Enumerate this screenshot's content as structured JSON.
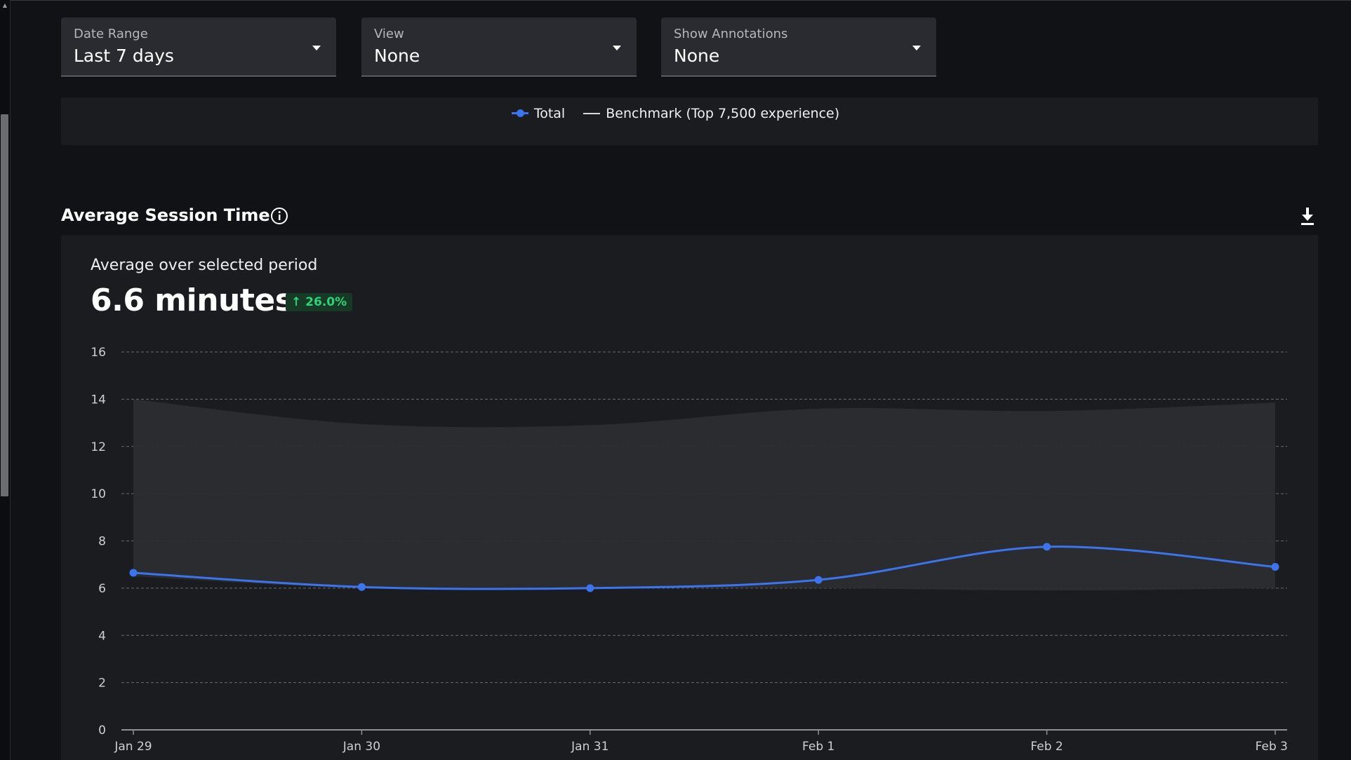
{
  "filters": {
    "date_range": {
      "label": "Date Range",
      "value": "Last 7 days"
    },
    "view": {
      "label": "View",
      "value": "None"
    },
    "annotations": {
      "label": "Show Annotations",
      "value": "None"
    }
  },
  "legend": {
    "total": "Total",
    "benchmark": "Benchmark (Top 7,500 experience)"
  },
  "section": {
    "title": "Average Session Time",
    "avg_label": "Average over selected period",
    "avg_value": "6.6 minutes",
    "delta": "26.0%",
    "delta_arrow": "↑"
  },
  "colors": {
    "series": "#3c74ee",
    "benchmark_band": "#2c2d32",
    "delta_green": "#2fd27a"
  },
  "chart_data": {
    "type": "line",
    "categories": [
      "Jan 29",
      "Jan 30",
      "Jan 31",
      "Feb 1",
      "Feb 2",
      "Feb 3"
    ],
    "series": [
      {
        "name": "Total",
        "values": [
          6.65,
          6.05,
          6.0,
          6.35,
          7.75,
          6.9
        ]
      }
    ],
    "benchmark_band": {
      "name": "Benchmark (Top 7,500 experience)",
      "upper": [
        14.0,
        12.95,
        12.9,
        13.6,
        13.5,
        13.85
      ],
      "lower": [
        6.5,
        6.0,
        6.0,
        6.0,
        5.9,
        6.0
      ]
    },
    "yticks": [
      0,
      2,
      4,
      6,
      8,
      10,
      12,
      14,
      16
    ],
    "ylim": [
      0,
      16
    ],
    "grid": true,
    "legend_position": "top-center"
  }
}
